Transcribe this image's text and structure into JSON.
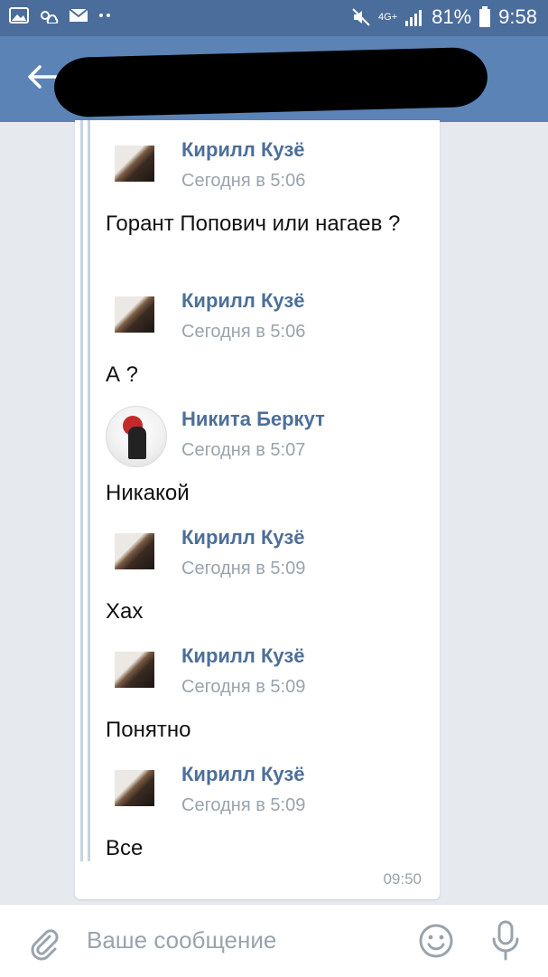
{
  "status_bar": {
    "network": "4G+",
    "battery": "81%",
    "time": "9:58",
    "icons_left": [
      "image-icon",
      "weather-icon",
      "mail-icon",
      "dots-icon"
    ]
  },
  "header": {
    "back_icon": "arrow-left-icon"
  },
  "messages": [
    {
      "author": "Кирилл Кузё",
      "time": "Сегодня в 5:06",
      "text": "Горант Попович или нагаев ?"
    },
    {
      "author": "Кирилл Кузё",
      "time": "Сегодня в 5:06",
      "text": "А ?"
    },
    {
      "author": "Никита Беркут",
      "time": "Сегодня в 5:07",
      "text": "Никакой"
    },
    {
      "author": "Кирилл Кузё",
      "time": "Сегодня в 5:09",
      "text": "Хах"
    },
    {
      "author": "Кирилл Кузё",
      "time": "Сегодня в 5:09",
      "text": "Понятно"
    },
    {
      "author": "Кирилл Кузё",
      "time": "Сегодня в 5:09",
      "text": "Все"
    }
  ],
  "card_time": "09:50",
  "composer": {
    "placeholder": "Ваше сообщение",
    "attach_icon": "paperclip-icon",
    "emoji_icon": "smile-icon",
    "mic_icon": "microphone-icon"
  },
  "colors": {
    "header": "#5b83b6",
    "status_bar": "#4a6d9b",
    "author_name": "#4d6f99",
    "background": "#e6e9ee"
  }
}
